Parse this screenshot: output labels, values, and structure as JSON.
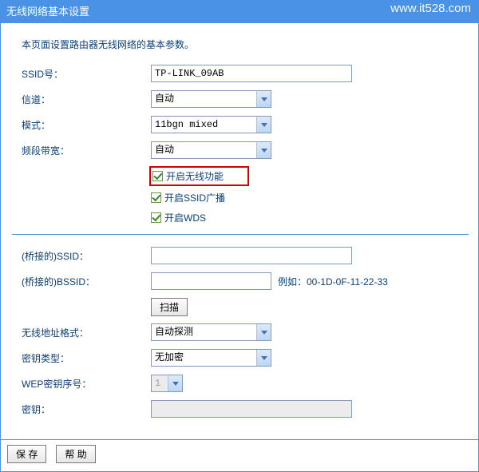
{
  "header": {
    "title": "无线网络基本设置"
  },
  "watermark": "www.it528.com",
  "intro": "本页面设置路由器无线网络的基本参数。",
  "labels": {
    "ssid": "SSID号：",
    "channel": "信道：",
    "mode": "模式：",
    "bandwidth": "频段带宽：",
    "bridge_ssid": "(桥接的)SSID：",
    "bridge_bssid": "(桥接的)BSSID：",
    "addr_fmt": "无线地址格式：",
    "key_type": "密钥类型：",
    "wep_idx": "WEP密钥序号：",
    "key": "密钥："
  },
  "values": {
    "ssid": "TP-LINK_09AB",
    "channel": "自动",
    "mode": "11bgn mixed",
    "bandwidth": "自动",
    "bridge_ssid": "",
    "bridge_bssid": "",
    "addr_fmt": "自动探测",
    "key_type": "无加密",
    "wep_idx": "1",
    "key": ""
  },
  "checks": {
    "enable_wireless": "开启无线功能",
    "enable_ssid_bcast": "开启SSID广播",
    "enable_wds": "开启WDS"
  },
  "hints": {
    "bssid_example": "例如：00-1D-0F-11-22-33"
  },
  "buttons": {
    "scan": "扫描",
    "save": "保 存",
    "help": "帮 助"
  }
}
